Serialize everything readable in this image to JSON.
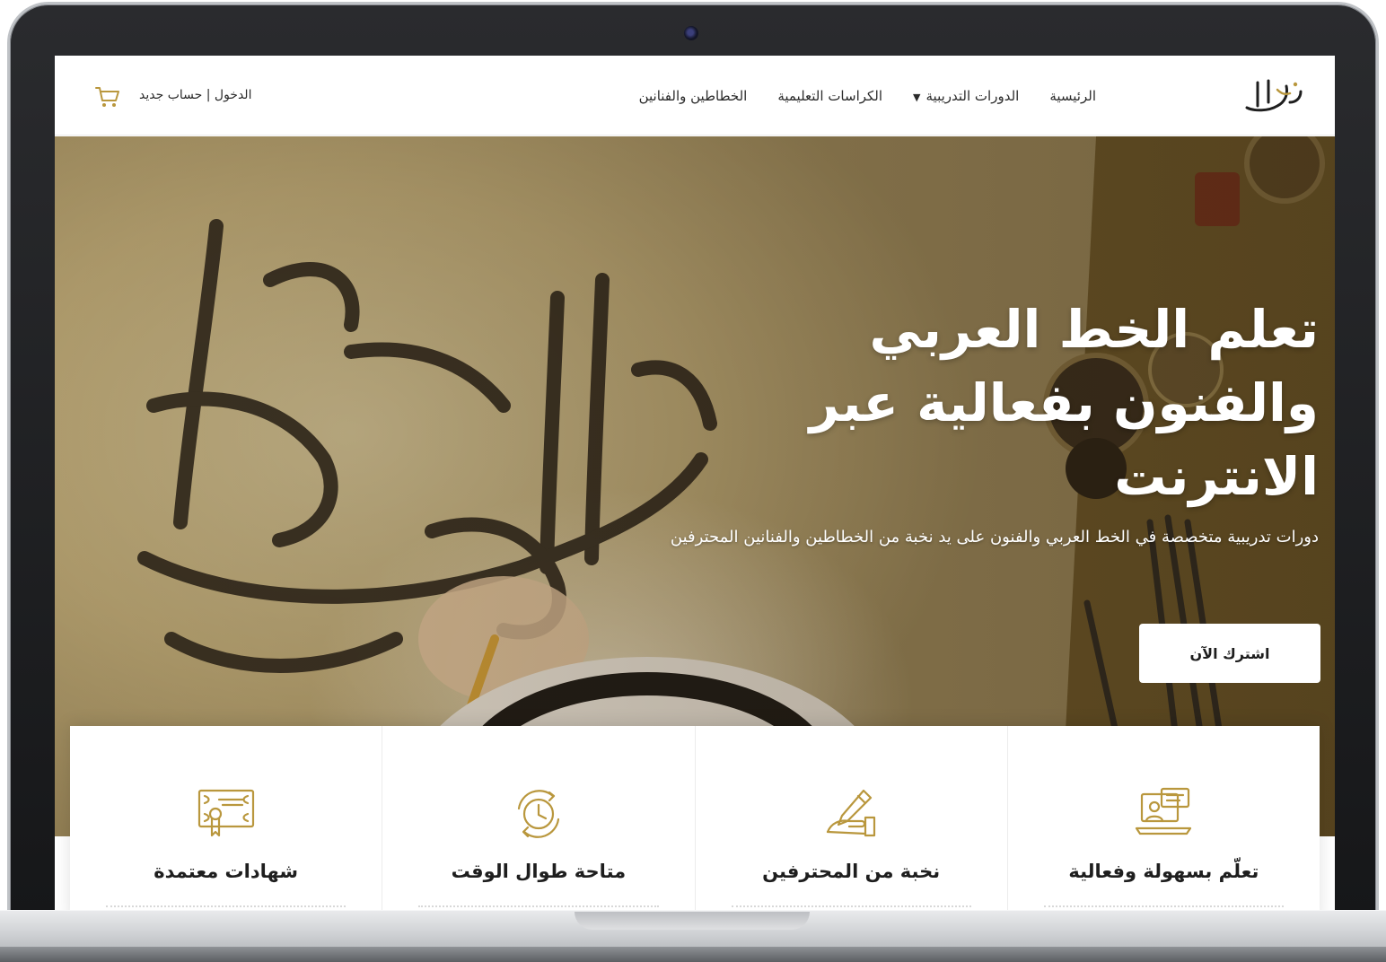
{
  "navbar": {
    "logo_alt": "الخطاط",
    "links": [
      "الرئيسية",
      "الدورات التدريبية",
      "الكراسات التعليمية",
      "الخطاطين والفنانين"
    ],
    "auth_text": "الدخول | حساب جديد"
  },
  "hero": {
    "title": "تعلم الخط العربي والفنون بفعالية عبر الانترنت",
    "subtitle": "دورات تدريبية متخصصة في الخط العربي والفنون على يد نخبة من الخطاطين والفنانين المحترفين",
    "cta_label": "اشترك الآن"
  },
  "features": [
    {
      "title": "تعلّم بسهولة وفعالية",
      "icon": "online-learning-icon"
    },
    {
      "title": "نخبة من المحترفين",
      "icon": "writing-hand-icon"
    },
    {
      "title": "متاحة طوال الوقت",
      "icon": "clock-cycle-icon"
    },
    {
      "title": "شهادات معتمدة",
      "icon": "certificate-icon"
    }
  ],
  "colors": {
    "accent": "#b9973d",
    "text": "#1e1e1e",
    "frame": "#1c1d20"
  }
}
